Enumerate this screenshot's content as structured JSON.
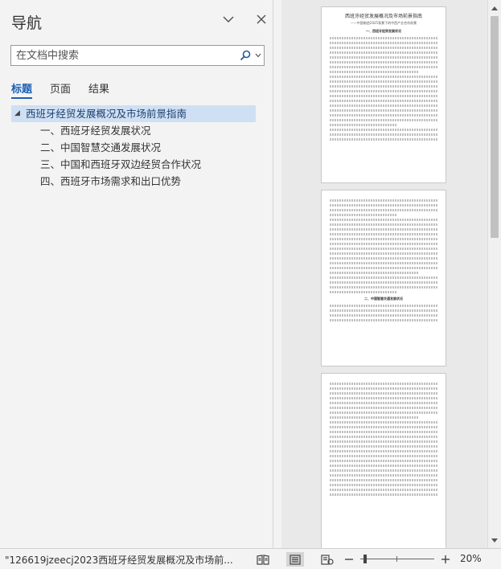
{
  "nav": {
    "title": "导航",
    "search_placeholder": "在文档中搜索",
    "tabs": [
      {
        "label": "标题",
        "active": true
      },
      {
        "label": "页面",
        "active": false
      },
      {
        "label": "结果",
        "active": false
      }
    ],
    "outline": {
      "root": "西班牙经贸发展概况及市场前景指南",
      "children": [
        "一、西班牙经贸发展状况",
        "二、中国智慧交通发展状况",
        "三、中国和西班牙双边经贸合作状况",
        "四、西班牙市场需求和出口优势"
      ]
    }
  },
  "document": {
    "page1_title": "西班牙经贸发展概况及市场前景指南",
    "page1_subtitle": "——中国制造2025背景下的中西产业合作前景",
    "page1_heading": "一、西班牙经贸发展状况",
    "page2_heading": "二、中国智慧交通发展状况"
  },
  "status": {
    "document_name": "\"126619jzeecj2023西班牙经贸发展概况及市场前...",
    "zoom_label": "20%",
    "zoom_level": 0.2
  }
}
